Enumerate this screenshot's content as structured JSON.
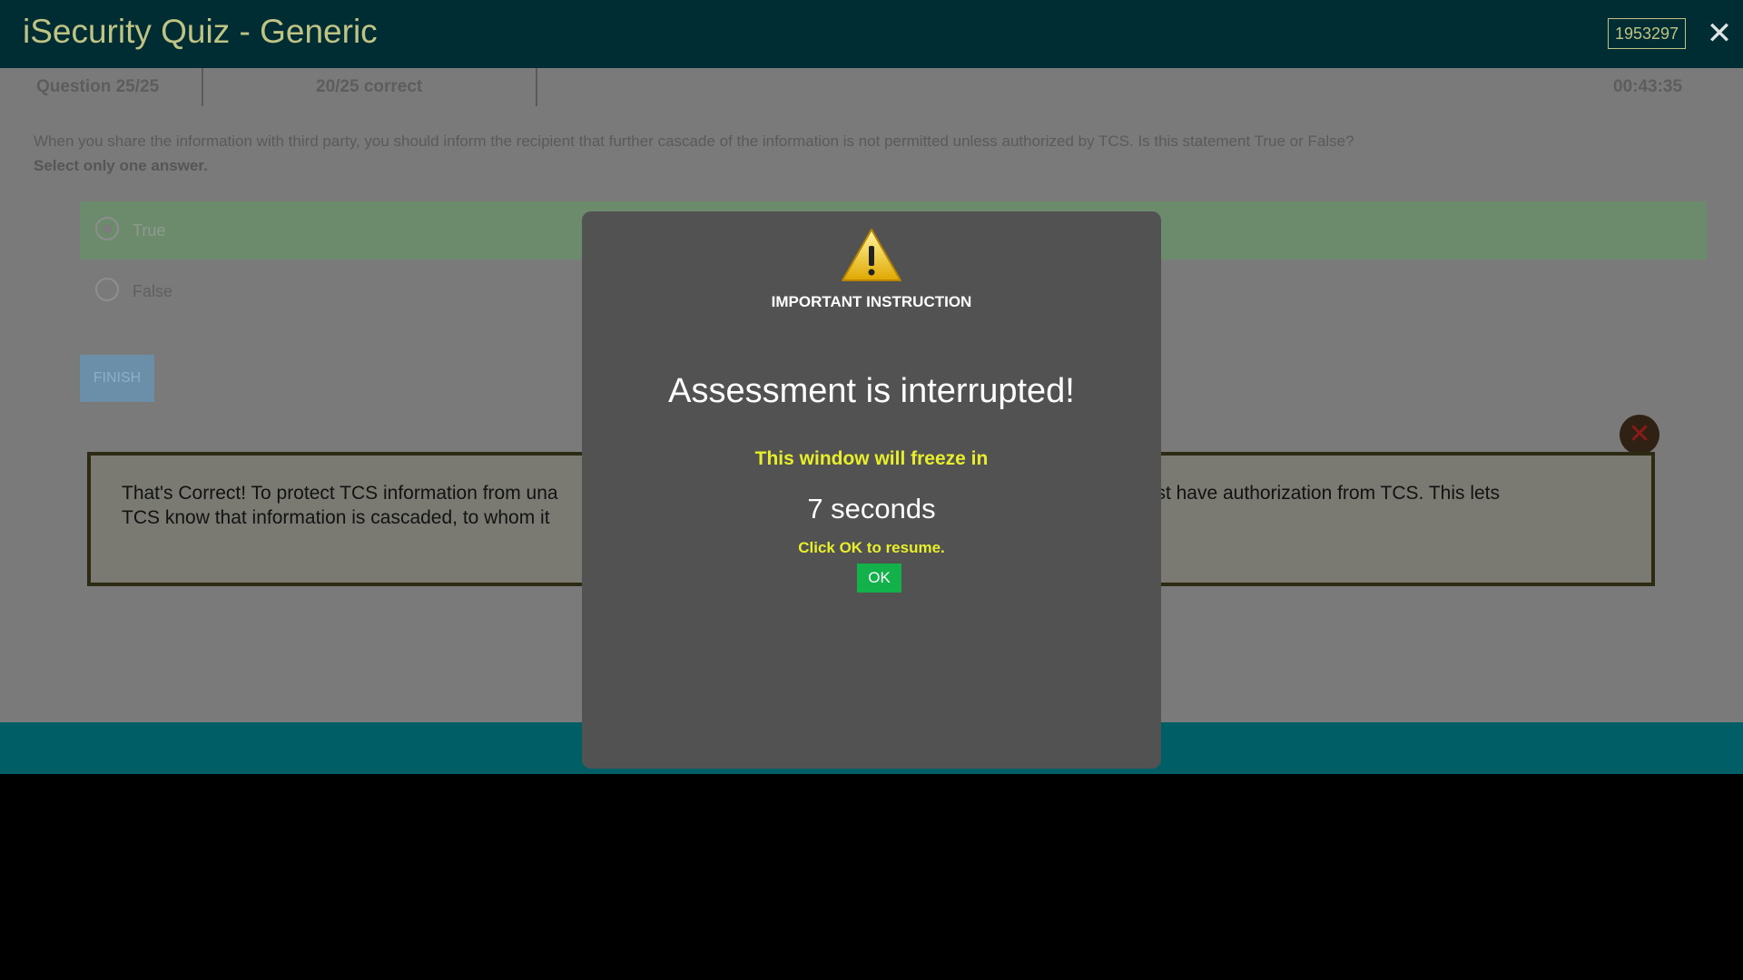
{
  "header": {
    "title": "iSecurity Quiz - Generic",
    "user_id": "1953297",
    "close_icon": "close-icon"
  },
  "status": {
    "question_counter": "Question 25/25",
    "score": "20/25 correct",
    "timer": "00:43:35"
  },
  "question": {
    "text": "When you share the information with third party, you should inform the recipient that further cascade of the information is not permitted unless authorized by TCS. Is this statement True or False?",
    "instruction": "Select only one answer.",
    "options": [
      {
        "label": "True",
        "selected": true
      },
      {
        "label": "False",
        "selected": false
      }
    ]
  },
  "finish_button": "FINISH",
  "feedback": {
    "text": "That's Correct! To protect TCS information from una… must have authorization from TCS. This lets TCS know that information is cascaded, to whom it…",
    "line1_left": "That's Correct! To protect TCS information from una",
    "line1_right": "must have authorization from TCS. This lets",
    "line2_left": "TCS know that information is cascaded, to whom it",
    "close_icon": "close-circle-icon"
  },
  "modal": {
    "icon": "warning-icon",
    "heading": "IMPORTANT INSTRUCTION",
    "title": "Assessment is interrupted!",
    "freeze_text": "This window will freeze in",
    "seconds": "7 seconds",
    "resume_text": "Click OK to resume.",
    "ok_label": "OK"
  },
  "colors": {
    "header_bg": "#002d33",
    "title_color": "#bfc383",
    "footer_bg": "#005f66",
    "modal_bg": "#525252",
    "highlight_yellow": "#e8ef2a",
    "ok_green": "#12b14a"
  }
}
